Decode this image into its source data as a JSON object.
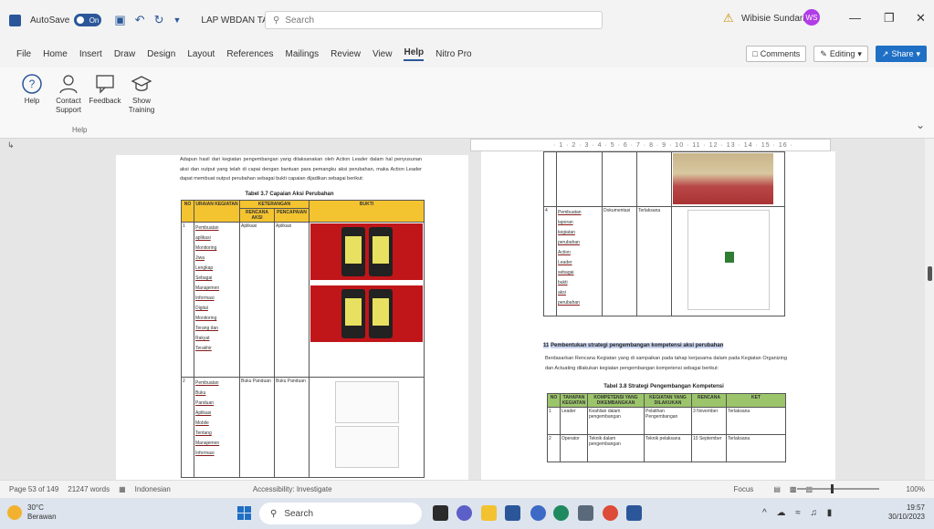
{
  "titlebar": {
    "autosave_label": "AutoSave",
    "autosave_state": "On",
    "doc_title": "LAP WBDAN TAHAP 1 ~",
    "search_placeholder": "Search",
    "user_name": "Wibisie Sundari",
    "user_initials": "WS"
  },
  "menu": {
    "items": [
      "File",
      "Home",
      "Insert",
      "Draw",
      "Design",
      "Layout",
      "References",
      "Mailings",
      "Review",
      "View",
      "Help",
      "Nitro Pro"
    ],
    "active": "Help",
    "comments": "Comments",
    "editing": "Editing",
    "share": "Share"
  },
  "ribbon": {
    "buttons": [
      {
        "label": "Help",
        "icon": "help-icon"
      },
      {
        "label": "Contact Support",
        "icon": "contact-support-icon"
      },
      {
        "label": "Feedback",
        "icon": "feedback-icon"
      },
      {
        "label": "Show Training",
        "icon": "training-icon"
      }
    ],
    "group": "Help"
  },
  "page1": {
    "intro": "Adapun hasil dari kegiatan pengembangan yang dilaksanakan oleh Action Leader dalam hal penyusunan aksi dan output yang telah di capai dengan bantuan para pemangku aksi perubahan, maka Action Leader dapat membuat output perubahan sebagai bukti capaian dijadikan sebagai berikut:",
    "caption": "Tabel 3.7 Capaian Aksi Perubahan",
    "headers": [
      "NO",
      "URAIAN KEGIATAN",
      "KETERANGAN",
      "BUKTI"
    ],
    "subheaders": [
      "RENCANA AKSI",
      "PENCAPAIAN"
    ],
    "rows": [
      {
        "no": "1",
        "uraian": [
          "Pembuatan",
          "aplikasi",
          "Monitoring",
          "Jiwa",
          "Lengkap",
          "Sebagai",
          "Manajemen",
          "Informasi",
          "Digital",
          "Monitoring",
          "Terang dan",
          "Rakyat",
          "Terakhir"
        ],
        "rencana": "Aplikasi",
        "capaian": "Aplikasi"
      },
      {
        "no": "2",
        "uraian": [
          "Pembuatan",
          "Buku",
          "Panduan",
          "Aplikasi",
          "Mobile",
          "Tentang",
          "Manajemen",
          "Informasi"
        ],
        "rencana": "Buku Panduan",
        "capaian": "Buku Panduan"
      }
    ]
  },
  "page2": {
    "row4": {
      "no": "4",
      "uraian": [
        "Pembuatan",
        "laporan",
        "kegiatan",
        "perubahan",
        "Action",
        "Leader",
        "sebagai",
        "bukti",
        "aksi",
        "perubahan"
      ],
      "col3": "Dokumentasi",
      "col4": "Terlaksana"
    },
    "heading_no": "11",
    "heading": "Pembentukan strategi pengembangan kompetensi aksi perubahan",
    "para": "Berdasarkan Rencana Kegiatan yang di sampaikan pada tahap kerjasama dalam pada Kegiatan Organizing dan Actuating dilakukan kegiatan pengembangan kompetensi sebagai berikut:",
    "caption": "Tabel 3.8 Strategi Pengembangan Kompetensi",
    "headers": [
      "NO",
      "TAHAPAN KEGIATAN",
      "KOMPETENSI YANG DIKEMBANGKAN",
      "KEGIATAN YANG DILAKUKAN",
      "RENCANA",
      "KET"
    ],
    "rows": [
      {
        "no": "1",
        "tahap": "Leader",
        "komp": "Keahlian dalam pengembangan",
        "keg": "Pelatihan Pengembangan",
        "ren": "3 November",
        "ket": "Terlaksana"
      },
      {
        "no": "2",
        "tahap": "Operator",
        "komp": "Teknik dalam pengembangan",
        "keg": "Teknik pelaksana",
        "ren": "10 September",
        "ket": "Terlaksana"
      }
    ]
  },
  "statusbar": {
    "page": "Page 53 of 149",
    "words": "21247 words",
    "language": "Indonesian",
    "accessibility": "Accessibility: Investigate",
    "focus": "Focus",
    "zoom": "100%"
  },
  "taskbar": {
    "temp": "30°C",
    "weather": "Berawan",
    "search": "Search",
    "time": "19:57",
    "date": "30/10/2023"
  }
}
